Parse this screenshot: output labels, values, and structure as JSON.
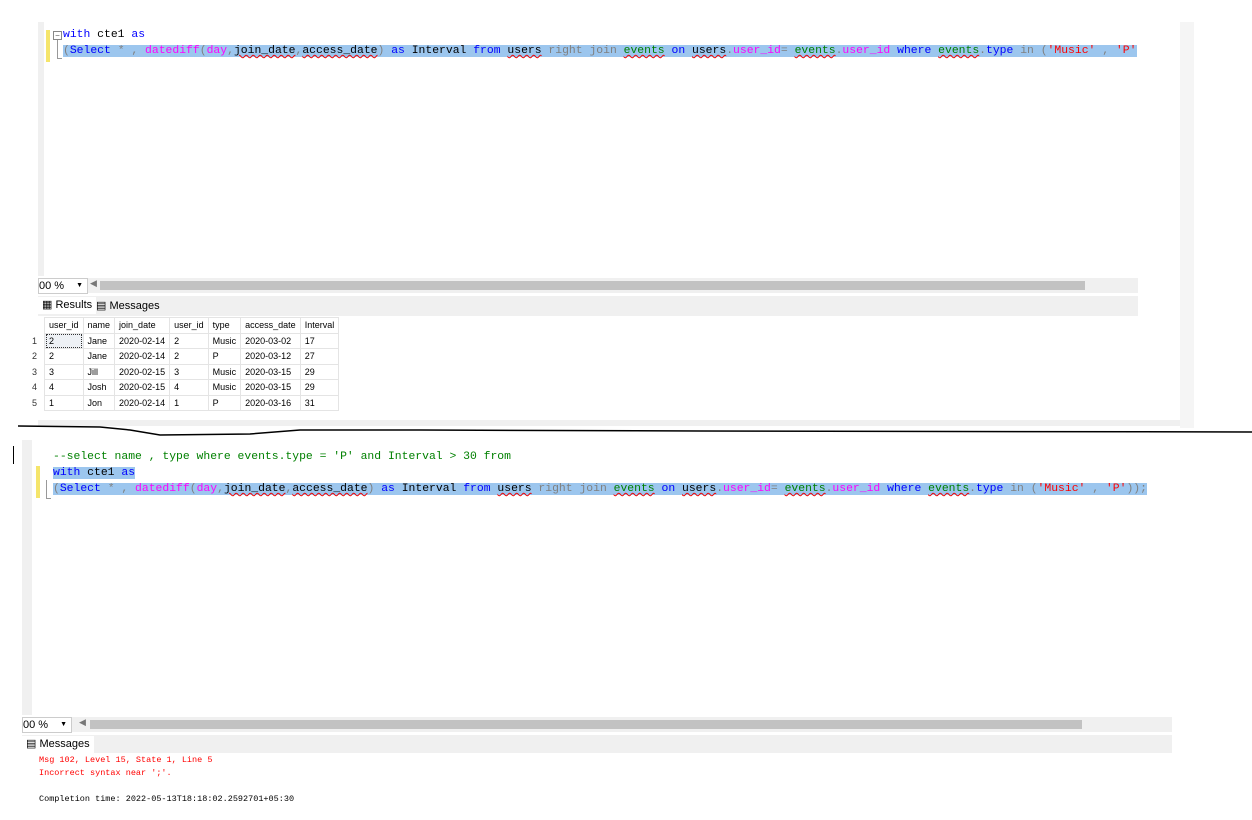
{
  "top_editor": {
    "lines": [
      [
        {
          "t": "with",
          "c": "k"
        },
        {
          "t": " cte1 ",
          "c": "b"
        },
        {
          "t": "as",
          "c": "k"
        }
      ],
      [
        {
          "t": "(",
          "c": "g"
        },
        {
          "t": "Select",
          "c": "k"
        },
        {
          "t": " * , ",
          "c": "g"
        },
        {
          "t": "datediff",
          "c": "f"
        },
        {
          "t": "(",
          "c": "g"
        },
        {
          "t": "day",
          "c": "f"
        },
        {
          "t": ",",
          "c": "g"
        },
        {
          "t": "join_date",
          "c": "u"
        },
        {
          "t": ",",
          "c": "g"
        },
        {
          "t": "access_date",
          "c": "u"
        },
        {
          "t": ") ",
          "c": "g"
        },
        {
          "t": "as",
          "c": "k"
        },
        {
          "t": " Interval ",
          "c": "b"
        },
        {
          "t": "from",
          "c": "k"
        },
        {
          "t": " ",
          "c": "b"
        },
        {
          "t": "users",
          "c": "u"
        },
        {
          "t": " right join ",
          "c": "g"
        },
        {
          "t": "events",
          "c": "t"
        },
        {
          "t": " ",
          "c": "b"
        },
        {
          "t": "on",
          "c": "k"
        },
        {
          "t": " ",
          "c": "b"
        },
        {
          "t": "users",
          "c": "u"
        },
        {
          "t": ".",
          "c": "g"
        },
        {
          "t": "user_id",
          "c": "f"
        },
        {
          "t": "= ",
          "c": "g"
        },
        {
          "t": "events",
          "c": "t"
        },
        {
          "t": ".",
          "c": "g"
        },
        {
          "t": "user_id",
          "c": "f"
        },
        {
          "t": " ",
          "c": "b"
        },
        {
          "t": "where",
          "c": "k"
        },
        {
          "t": " ",
          "c": "b"
        },
        {
          "t": "events",
          "c": "t"
        },
        {
          "t": ".",
          "c": "g"
        },
        {
          "t": "type",
          "c": "k"
        },
        {
          "t": " in (",
          "c": "g"
        },
        {
          "t": "'Music'",
          "c": "s"
        },
        {
          "t": " , ",
          "c": "g"
        },
        {
          "t": "'P'",
          "c": "s"
        },
        {
          "t": "));",
          "c": "g"
        }
      ]
    ]
  },
  "top_zoom": "00 %",
  "result_tabs": [
    "Results",
    "Messages"
  ],
  "grid": {
    "columns": [
      "user_id",
      "name",
      "join_date",
      "user_id",
      "type",
      "access_date",
      "Interval"
    ],
    "row_numbers": [
      "1",
      "2",
      "3",
      "4",
      "5"
    ],
    "rows": [
      [
        "2",
        "Jane",
        "2020-02-14",
        "2",
        "Music",
        "2020-03-02",
        "17"
      ],
      [
        "2",
        "Jane",
        "2020-02-14",
        "2",
        "P",
        "2020-03-12",
        "27"
      ],
      [
        "3",
        "Jill",
        "2020-02-15",
        "3",
        "Music",
        "2020-03-15",
        "29"
      ],
      [
        "4",
        "Josh",
        "2020-02-15",
        "4",
        "Music",
        "2020-03-15",
        "29"
      ],
      [
        "1",
        "Jon",
        "2020-02-14",
        "1",
        "P",
        "2020-03-16",
        "31"
      ]
    ]
  },
  "bottom_editor": {
    "lines": [
      [
        {
          "t": "--select name , type where events.type = 'P' and Interval > 30 from",
          "c": "c"
        }
      ],
      [
        {
          "t": "with",
          "c": "k"
        },
        {
          "t": " cte1 ",
          "c": "b"
        },
        {
          "t": "as",
          "c": "k"
        }
      ],
      [
        {
          "t": "(",
          "c": "g"
        },
        {
          "t": "Select",
          "c": "k"
        },
        {
          "t": " * , ",
          "c": "g"
        },
        {
          "t": "datediff",
          "c": "f"
        },
        {
          "t": "(",
          "c": "g"
        },
        {
          "t": "day",
          "c": "f"
        },
        {
          "t": ",",
          "c": "g"
        },
        {
          "t": "join_date",
          "c": "u"
        },
        {
          "t": ",",
          "c": "g"
        },
        {
          "t": "access_date",
          "c": "u"
        },
        {
          "t": ") ",
          "c": "g"
        },
        {
          "t": "as",
          "c": "k"
        },
        {
          "t": " Interval ",
          "c": "b"
        },
        {
          "t": "from",
          "c": "k"
        },
        {
          "t": " ",
          "c": "b"
        },
        {
          "t": "users",
          "c": "u"
        },
        {
          "t": " right join ",
          "c": "g"
        },
        {
          "t": "events",
          "c": "t"
        },
        {
          "t": " ",
          "c": "b"
        },
        {
          "t": "on",
          "c": "k"
        },
        {
          "t": " ",
          "c": "b"
        },
        {
          "t": "users",
          "c": "u"
        },
        {
          "t": ".",
          "c": "g"
        },
        {
          "t": "user_id",
          "c": "f"
        },
        {
          "t": "= ",
          "c": "g"
        },
        {
          "t": "events",
          "c": "t"
        },
        {
          "t": ".",
          "c": "g"
        },
        {
          "t": "user_id",
          "c": "f"
        },
        {
          "t": " ",
          "c": "b"
        },
        {
          "t": "where",
          "c": "k"
        },
        {
          "t": " ",
          "c": "b"
        },
        {
          "t": "events",
          "c": "t"
        },
        {
          "t": ".",
          "c": "g"
        },
        {
          "t": "type",
          "c": "k"
        },
        {
          "t": " in (",
          "c": "g"
        },
        {
          "t": "'Music'",
          "c": "s"
        },
        {
          "t": " , ",
          "c": "g"
        },
        {
          "t": "'P'",
          "c": "s"
        },
        {
          "t": "));",
          "c": "g"
        }
      ]
    ]
  },
  "bottom_zoom": "00 %",
  "bottom_tab": "Messages",
  "messages": {
    "error_line1": "Msg 102, Level 15, State 1, Line 5",
    "error_line2": "Incorrect syntax near ';'.",
    "completion": "Completion time: 2022-05-13T18:18:02.2592701+05:30"
  }
}
